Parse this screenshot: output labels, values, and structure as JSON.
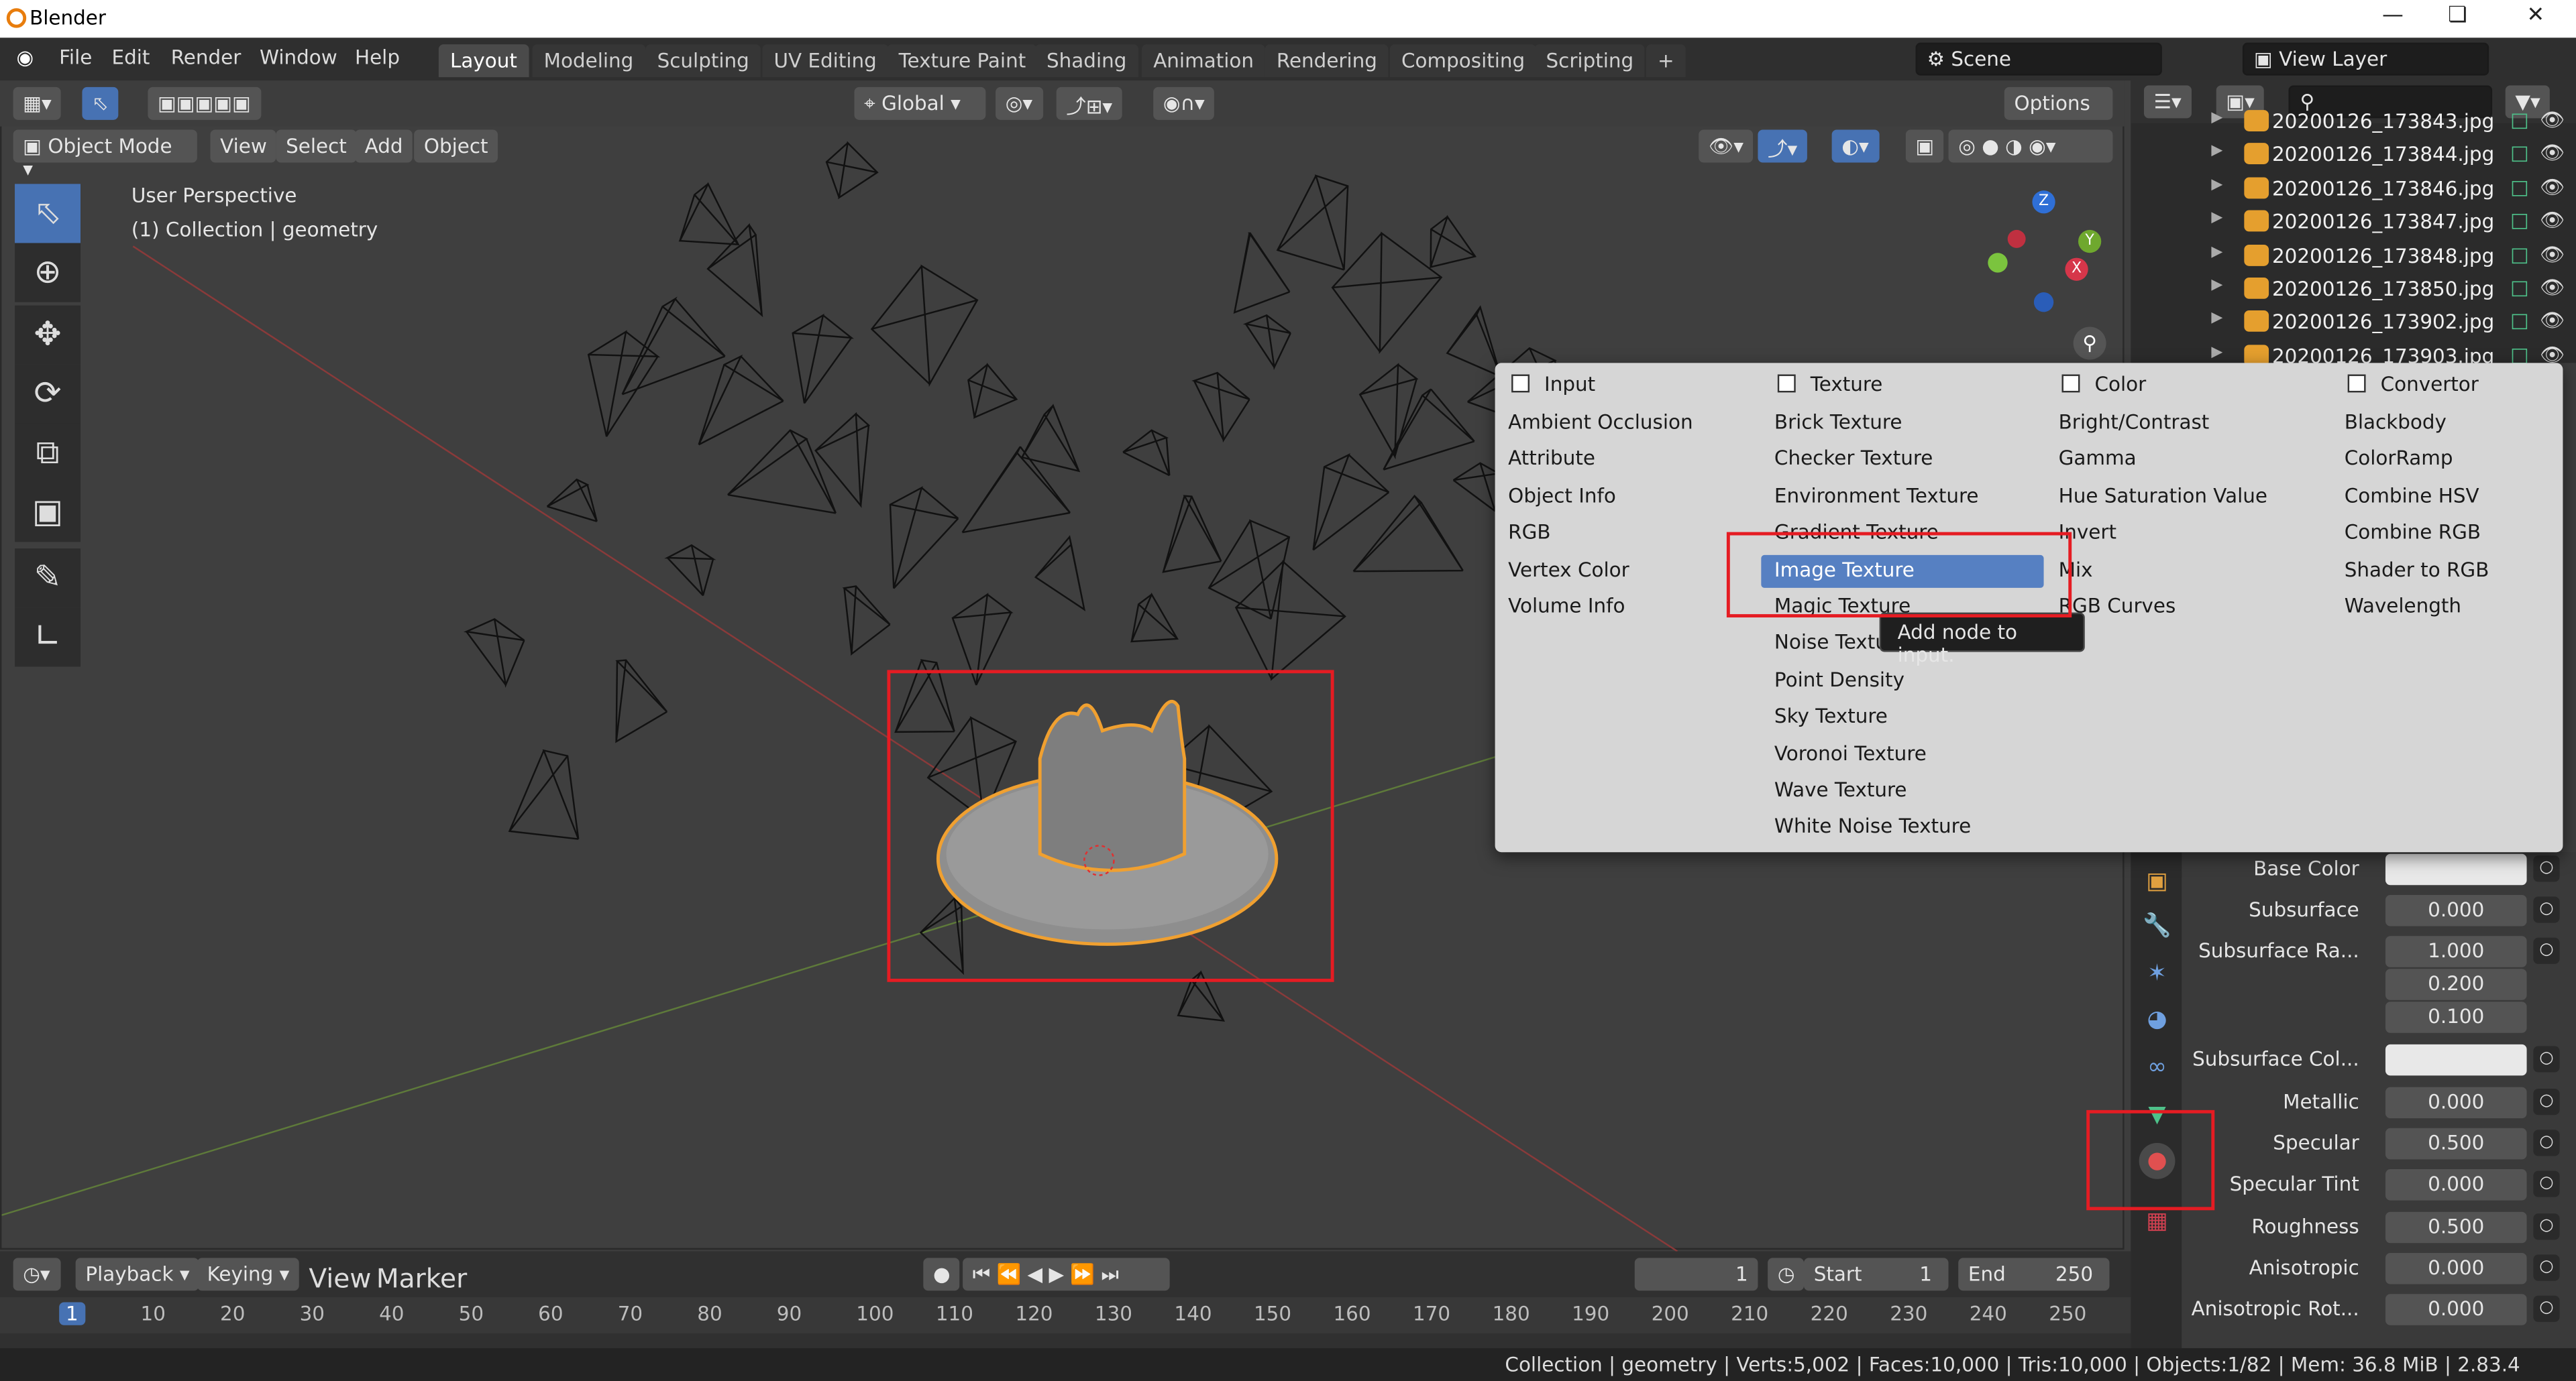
{
  "app": {
    "title": "Blender"
  },
  "menu": [
    "File",
    "Edit",
    "Render",
    "Window",
    "Help"
  ],
  "workspaces": [
    "Layout",
    "Modeling",
    "Sculpting",
    "UV Editing",
    "Texture Paint",
    "Shading",
    "Animation",
    "Rendering",
    "Compositing",
    "Scripting"
  ],
  "active_workspace": "Layout",
  "scene": {
    "label": "Scene",
    "view_layer": "View Layer"
  },
  "viewport_header": {
    "transform": "Global",
    "options": "Options",
    "mode": "Object Mode",
    "menus": [
      "View",
      "Select",
      "Add",
      "Object"
    ]
  },
  "overlay": {
    "perspective": "User Perspective",
    "collection": "(1) Collection | geometry"
  },
  "outliner": {
    "items": [
      "20200126_173843.jpg",
      "20200126_173844.jpg",
      "20200126_173846.jpg",
      "20200126_173847.jpg",
      "20200126_173848.jpg",
      "20200126_173850.jpg",
      "20200126_173902.jpg",
      "20200126_173903.jpg"
    ]
  },
  "popup": {
    "columns": [
      {
        "header": "Input",
        "items": [
          "Ambient Occlusion",
          "Attribute",
          "Object Info",
          "RGB",
          "Vertex Color",
          "Volume Info"
        ]
      },
      {
        "header": "Texture",
        "items": [
          "Brick Texture",
          "Checker Texture",
          "Environment Texture",
          "Gradient Texture",
          "Image Texture",
          "Magic Texture",
          "Noise Texture",
          "Point Density",
          "Sky Texture",
          "Voronoi Texture",
          "Wave Texture",
          "White Noise Texture"
        ]
      },
      {
        "header": "Color",
        "items": [
          "Bright/Contrast",
          "Gamma",
          "Hue Saturation Value",
          "Invert",
          "Mix",
          "RGB Curves"
        ]
      },
      {
        "header": "Convertor",
        "items": [
          "Blackbody",
          "ColorRamp",
          "Combine HSV",
          "Combine RGB",
          "Shader to RGB",
          "Wavelength"
        ]
      }
    ],
    "selected": "Image Texture",
    "tooltip": "Add node to input."
  },
  "properties": {
    "rows": [
      {
        "label": "Base Color",
        "value": ""
      },
      {
        "label": "Subsurface",
        "value": "0.000"
      },
      {
        "label": "Subsurface Ra...",
        "value": "1.000"
      },
      {
        "label": "",
        "value": "0.200"
      },
      {
        "label": "",
        "value": "0.100"
      },
      {
        "label": "Subsurface Col...",
        "value": ""
      },
      {
        "label": "Metallic",
        "value": "0.000"
      },
      {
        "label": "Specular",
        "value": "0.500"
      },
      {
        "label": "Specular Tint",
        "value": "0.000"
      },
      {
        "label": "Roughness",
        "value": "0.500"
      },
      {
        "label": "Anisotropic",
        "value": "0.000"
      },
      {
        "label": "Anisotropic Rot...",
        "value": "0.000"
      }
    ]
  },
  "timeline": {
    "menus": [
      "Playback",
      "Keying",
      "View",
      "Marker"
    ],
    "current_frame": "1",
    "start_label": "Start",
    "start": "1",
    "end_label": "End",
    "end": "250",
    "ticks": [
      "1",
      "10",
      "20",
      "30",
      "40",
      "50",
      "60",
      "70",
      "80",
      "90",
      "100",
      "110",
      "120",
      "130",
      "140",
      "150",
      "160",
      "170",
      "180",
      "190",
      "200",
      "210",
      "220",
      "230",
      "240",
      "250"
    ]
  },
  "status": {
    "text": "Collection | geometry | Verts:5,002 | Faces:10,000 | Tris:10,000 | Objects:1/82 | Mem: 36.8 MiB | 2.83.4"
  },
  "gizmo": {
    "z": "Z",
    "y": "Y",
    "x": "X"
  },
  "colors": {
    "accent": "#4772b3",
    "selection": "#5680c2",
    "highlight_box": "#e51c23",
    "object_outline": "#f0a030"
  }
}
